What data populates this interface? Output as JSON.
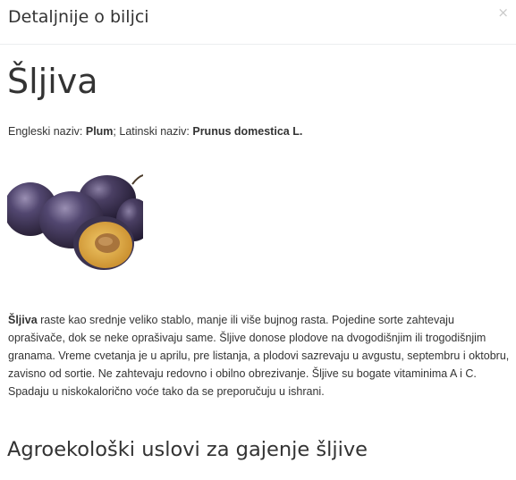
{
  "modal": {
    "title": "Detaljnije o biljci",
    "close_label": "×"
  },
  "plant": {
    "name": "Šljiva",
    "english_label": "Engleski naziv: ",
    "english_name": "Plum",
    "separator": "; ",
    "latin_label": "Latinski naziv: ",
    "latin_name": "Prunus domestica L.",
    "image_icon": "plum-photo",
    "description_lead": "Šljiva",
    "description": " raste kao srednje veliko stablo, manje ili više bujnog rasta. Pojedine sorte zahtevaju oprašivače, dok se neke oprašivaju same. Šljive donose plodove na dvogodišnjim ili trogodišnjim granama. Vreme cvetanja je u aprilu, pre listanja, a plodovi sazrevaju u avgustu, septembru i oktobru, zavisno od sortie. Ne zahtevaju redovno i obilno obrezivanje. Šljive su bogate vitaminima A i C. Spadaju u niskokalorično voće tako da se preporučuju u ishrani."
  },
  "sections": {
    "heading_1": "Agroekološki uslovi za gajenje šljive"
  },
  "colors": {
    "text": "#333333",
    "close": "#c9c9c9",
    "divider": "#eceeef",
    "plum_skin": "#3b3350",
    "plum_flesh": "#d9a54a",
    "pit": "#a8743c"
  }
}
